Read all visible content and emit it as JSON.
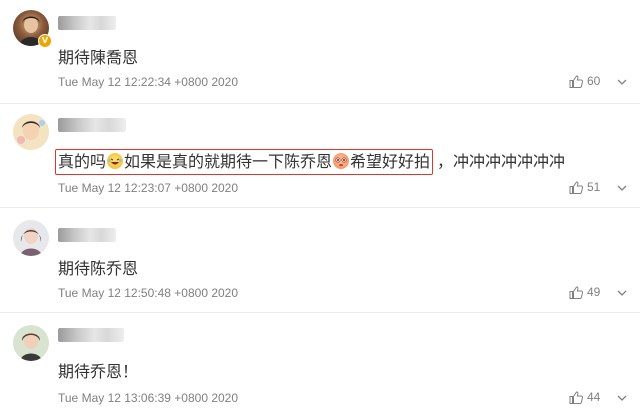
{
  "comments": [
    {
      "text": "期待陳喬恩",
      "timestamp": "Tue May 12 12:22:34 +0800 2020",
      "likes": "60",
      "verified_badge": "V"
    },
    {
      "text_part1": "真的吗",
      "text_part2": "如果是真的就期待一下陈乔恩",
      "text_part3": "希望好好拍",
      "text_part4": "，冲冲冲冲冲冲冲",
      "timestamp": "Tue May 12 12:23:07 +0800 2020",
      "likes": "51",
      "highlight_color": "#e0342c"
    },
    {
      "text": "期待陈乔恩",
      "timestamp": "Tue May 12 12:50:48 +0800 2020",
      "likes": "49"
    },
    {
      "text": "期待乔恩！",
      "timestamp": "Tue May 12 13:06:39 +0800 2020",
      "likes": "44"
    }
  ],
  "icons": {
    "like": "thumbs-up-icon",
    "more": "chevron-down-icon",
    "emoji_laugh": "laughing-emoji-icon",
    "emoji_eyes": "drooling-emoji-icon"
  }
}
